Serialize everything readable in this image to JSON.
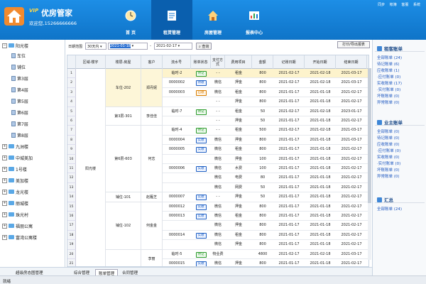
{
  "header": {
    "vip": "VIP",
    "brand": "优房管家",
    "welcome": "欢迎您,15266666666",
    "nav": [
      {
        "label": "首 页",
        "icon": "clock-icon"
      },
      {
        "label": "租赁管理",
        "icon": "document-icon"
      },
      {
        "label": "房屋管理",
        "icon": "house-icon"
      },
      {
        "label": "报表中心",
        "icon": "report-icon"
      }
    ],
    "top_links": [
      "同步",
      "帐簿",
      "客服",
      "系统"
    ]
  },
  "sidebar": {
    "root": "阳光楼",
    "children": [
      "车位",
      "铺位",
      "第3层",
      "第4层",
      "第5层",
      "第6层",
      "第7层",
      "第8层"
    ],
    "others": [
      "九洲楼",
      "中城美加",
      "1号楼",
      "美加楼",
      "龙光楼",
      "丽城楼",
      "珠光村",
      "福朋公寓",
      "富湾公寓楼"
    ],
    "footer": "超级房态图管理"
  },
  "filter": {
    "label": "日期范围",
    "range": "30天内",
    "start": "2021-01-18",
    "sep": "-",
    "end": "2021-02-17",
    "search": "查询",
    "print": "打印/导出报表"
  },
  "table": {
    "headers": [
      "区域-楼宇",
      "楼层-房屋",
      "客户",
      "流水号",
      "账单状态",
      "支付方式",
      "费用项目",
      "金额",
      "记账日期",
      "开始日期",
      "结束日期"
    ],
    "rows": [
      [
        "",
        "",
        "",
        "临时-2",
        "待记",
        "- -",
        "租金",
        "800",
        "2021-02-17",
        "2021-02-18",
        "2021-03-17"
      ],
      [
        "",
        "",
        "",
        "0000002",
        "待收",
        "微信",
        "押金",
        "800",
        "2021-02-17",
        "2021-02-18",
        "2021-03-17"
      ],
      [
        "",
        "",
        "",
        "0000003",
        "已收",
        "微信",
        "租金",
        "800",
        "2021-01-17",
        "2021-01-18",
        "2021-02-17"
      ],
      [
        "",
        "",
        "",
        "",
        "",
        "- -",
        "押金",
        "800",
        "2021-01-17",
        "2021-01-18",
        "2021-02-17"
      ],
      [
        "",
        "",
        "",
        "临时-7",
        "待记",
        "- -",
        "租金",
        "50",
        "2021-02-17",
        "2021-02-18",
        "2023-01-17"
      ],
      [
        "",
        "",
        "",
        "",
        "",
        "- -",
        "押金",
        "50",
        "2021-01-17",
        "2021-01-18",
        "2021-02-17"
      ],
      [
        "",
        "",
        "",
        "临时-4",
        "待记",
        "- -",
        "租金",
        "500",
        "2021-02-17",
        "2021-02-18",
        "2021-03-17"
      ],
      [
        "",
        "",
        "",
        "0000004",
        "实收",
        "微信",
        "押金",
        "800",
        "2021-01-17",
        "2021-01-18",
        "2021-03-17"
      ],
      [
        "",
        "",
        "",
        "0000005",
        "实收",
        "微信",
        "租金",
        "800",
        "2021-01-17",
        "2021-01-18",
        "2021-02-17"
      ],
      [
        "",
        "",
        "",
        "",
        "",
        "微信",
        "押金",
        "100",
        "2021-01-17",
        "2021-01-18",
        "2021-02-17"
      ],
      [
        "",
        "",
        "",
        "0000006",
        "实收",
        "微信",
        "水费",
        "100",
        "2021-01-17",
        "2021-01-18",
        "2021-02-17"
      ],
      [
        "",
        "",
        "",
        "",
        "",
        "微信",
        "电费",
        "80",
        "2021-01-17",
        "2021-01-18",
        "2021-02-17"
      ],
      [
        "",
        "",
        "",
        "",
        "",
        "微信",
        "网费",
        "50",
        "2021-01-17",
        "2021-01-18",
        "2021-02-17"
      ],
      [
        "",
        "",
        "",
        "0000007",
        "实收",
        "- -",
        "押金",
        "50",
        "2021-01-17",
        "2021-01-18",
        "2021-02-17"
      ],
      [
        "",
        "",
        "",
        "0000012",
        "实收",
        "微信",
        "押金",
        "800",
        "2021-01-17",
        "2021-01-18",
        "2021-02-17"
      ],
      [
        "",
        "",
        "",
        "0000013",
        "实收",
        "微信",
        "租金",
        "800",
        "2021-01-17",
        "2021-01-18",
        "2021-02-17"
      ],
      [
        "",
        "",
        "",
        "",
        "",
        "微信",
        "押金",
        "800",
        "2021-01-17",
        "2021-01-18",
        "2021-02-17"
      ],
      [
        "",
        "",
        "",
        "0000014",
        "实收",
        "微信",
        "租金",
        "800",
        "2021-01-17",
        "2021-01-18",
        "2021-02-17"
      ],
      [
        "",
        "",
        "",
        "",
        "",
        "微信",
        "押金",
        "800",
        "2021-01-17",
        "2021-01-18",
        "2021-02-17"
      ],
      [
        "",
        "",
        "",
        "临时-5",
        "待记",
        "物业费",
        "",
        "4800",
        "2021-02-17",
        "2021-02-18",
        "2021-03-17"
      ],
      [
        "",
        "",
        "",
        "0000015",
        "实收",
        "微信",
        "押金",
        "800",
        "2021-01-17",
        "2021-01-18",
        "2021-02-17"
      ]
    ],
    "merged": {
      "area": "阳光楼",
      "rooms": [
        "车位-202",
        "第3层-301",
        "第6层-603",
        "铺位-101",
        "铺位-102",
        ""
      ],
      "customers": [
        "郑丹妮",
        "李佳佳",
        "何志",
        "赵雁芝",
        "何金金",
        "李丽"
      ]
    }
  },
  "bottom_tabs": [
    "综合管理",
    "账单管理",
    "合同管理"
  ],
  "right_panel": {
    "sections": [
      {
        "title": "租客账单",
        "items": [
          "全部账单 (24)",
          "待记账单 (6)",
          "应收账单 (1)",
          "·应付账单 (0)",
          "实收账单 (17)",
          "·实付账单 (0)",
          "坏账账单 (0)",
          "异常账单 (0)"
        ]
      },
      {
        "title": "业主账单",
        "items": [
          "全部账单 (0)",
          "待记账单 (0)",
          "应收账单 (0)",
          "·应付账单 (0)",
          "实收账单 (0)",
          "·实付账单 (0)",
          "坏账账单 (0)",
          "异常账单 (0)"
        ]
      },
      {
        "title": "汇总",
        "items": [
          "全部账单 (24)"
        ]
      }
    ]
  },
  "status": "就绪"
}
